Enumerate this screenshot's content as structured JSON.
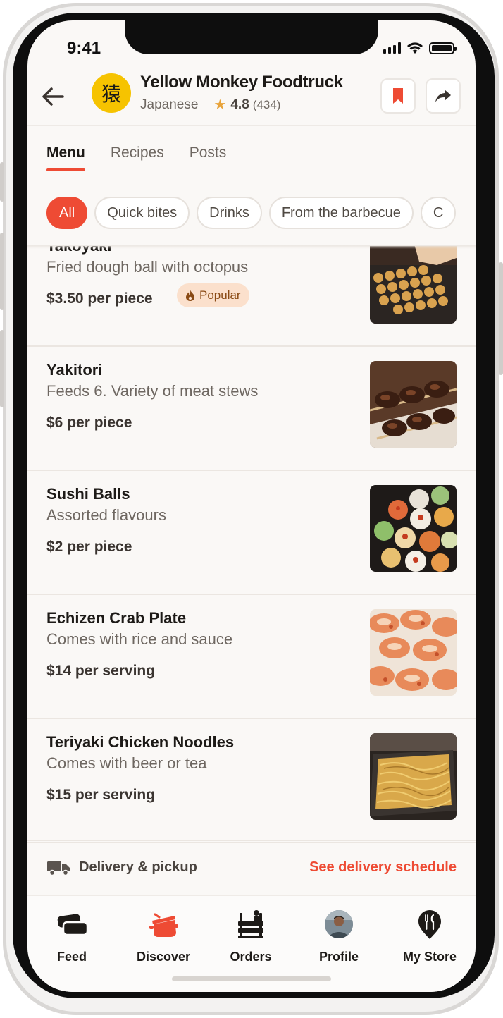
{
  "status_bar": {
    "time": "9:41"
  },
  "store": {
    "logo_glyph": "猿",
    "name": "Yellow Monkey Foodtruck",
    "cuisine": "Japanese",
    "rating": "4.8",
    "review_count": "(434)"
  },
  "tabs": [
    {
      "label": "Menu",
      "active": true
    },
    {
      "label": "Recipes",
      "active": false
    },
    {
      "label": "Posts",
      "active": false
    }
  ],
  "chips": [
    {
      "label": "All",
      "active": true
    },
    {
      "label": "Quick bites",
      "active": false
    },
    {
      "label": "Drinks",
      "active": false
    },
    {
      "label": "From the barbecue",
      "active": false
    },
    {
      "label": "C",
      "active": false
    }
  ],
  "menu_items": [
    {
      "name": "Takoyaki",
      "description": "Fried dough ball with octopus",
      "price": "$3.50 per piece",
      "badge": "Popular",
      "image": "takoyaki-photo"
    },
    {
      "name": "Yakitori",
      "description": "Feeds 6. Variety of meat stews",
      "price": "$6 per piece",
      "image": "yakitori-photo"
    },
    {
      "name": "Sushi Balls",
      "description": "Assorted flavours",
      "price": "$2 per piece",
      "image": "sushi-balls-photo"
    },
    {
      "name": "Echizen Crab Plate",
      "description": "Comes with rice and sauce",
      "price": "$14 per serving",
      "image": "crab-plate-photo"
    },
    {
      "name": "Teriyaki Chicken Noodles",
      "description": "Comes with beer or tea",
      "price": "$15 per serving",
      "image": "noodles-photo"
    }
  ],
  "delivery": {
    "label": "Delivery & pickup",
    "link": "See delivery schedule"
  },
  "bottom_nav": [
    {
      "label": "Feed",
      "icon": "feed-icon",
      "active": false
    },
    {
      "label": "Discover",
      "icon": "pot-icon",
      "active": true
    },
    {
      "label": "Orders",
      "icon": "orders-icon",
      "active": false
    },
    {
      "label": "Profile",
      "icon": "avatar",
      "active": false
    },
    {
      "label": "My Store",
      "icon": "store-pin-icon",
      "active": false
    }
  ],
  "colors": {
    "accent": "#ee4b34",
    "brand_yellow": "#f6c300",
    "background": "#faf8f6",
    "badge_bg": "#fbe0cc"
  }
}
